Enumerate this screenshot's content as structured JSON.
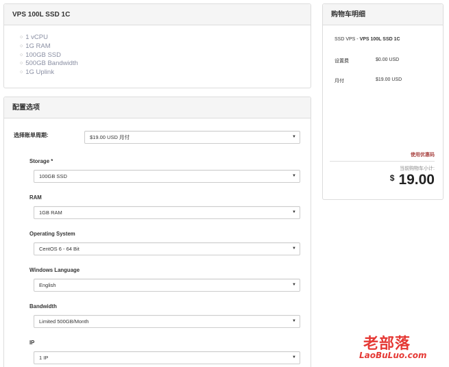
{
  "product": {
    "title": "VPS 100L SSD 1C",
    "features": [
      "1 vCPU",
      "1G RAM",
      "100GB SSD",
      "500GB Bandwidth",
      "1G Uplink"
    ]
  },
  "config": {
    "title": "配置选项",
    "billing_label": "选择账单周期:",
    "billing_value": "$19.00 USD 月付",
    "options": [
      {
        "label": "Storage *",
        "value": "100GB SSD"
      },
      {
        "label": "RAM",
        "value": "1GB RAM"
      },
      {
        "label": "Operating System",
        "value": "CentOS 6 - 64 Bit"
      },
      {
        "label": "Windows Language",
        "value": "English"
      },
      {
        "label": "Bandwidth",
        "value": "Limited 500GB/Month"
      },
      {
        "label": "IP",
        "value": "1 IP"
      }
    ]
  },
  "cart": {
    "title": "购物车明细",
    "product_prefix": "SSD VPS - ",
    "product_name": "VPS 100L SSD 1C",
    "setup_label": "设置费",
    "setup_value": "$0.00 USD",
    "monthly_label": "月付",
    "monthly_value": "$19.00 USD",
    "coupon_link": "使用优惠码",
    "subtotal_label": "当前购物车小计:",
    "currency_symbol": "$",
    "total": "19.00"
  },
  "watermark": {
    "cn": "老部落",
    "en": "LaoBuLuo.com"
  },
  "icons": {
    "select_caret": "caret-down-icon",
    "list_bullet": "circle-bullet-icon"
  }
}
